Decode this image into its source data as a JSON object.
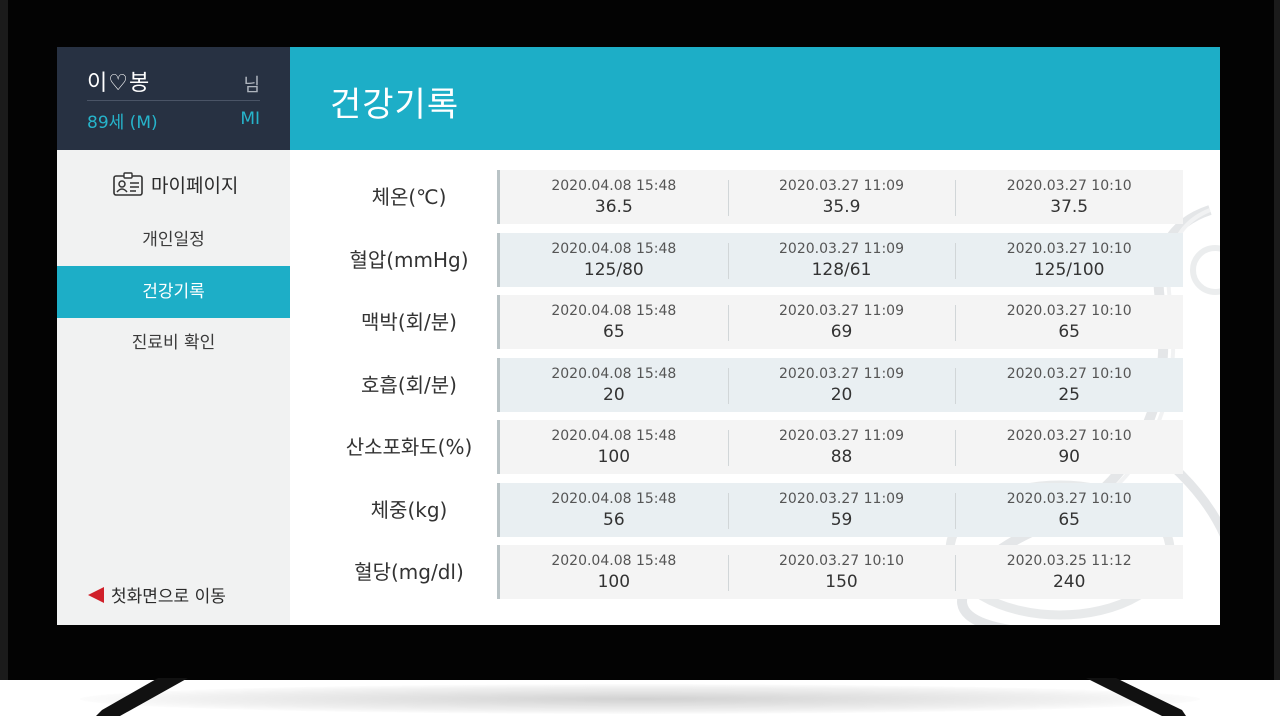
{
  "profile": {
    "name": "이♡봉",
    "honorific": "님",
    "age_num": "89",
    "age_suffix": "세 (M)",
    "grade": "MI"
  },
  "sidebar": {
    "mypage_label": "마이페이지",
    "items": [
      {
        "label": "개인일정",
        "active": false
      },
      {
        "label": "건강기록",
        "active": true
      },
      {
        "label": "진료비 확인",
        "active": false
      }
    ],
    "home_label": "첫화면으로 이동"
  },
  "header": {
    "title": "건강기록"
  },
  "records": [
    {
      "label": "체온(℃)",
      "entries": [
        {
          "date": "2020.04.08 15:48",
          "value": "36.5"
        },
        {
          "date": "2020.03.27 11:09",
          "value": "35.9"
        },
        {
          "date": "2020.03.27 10:10",
          "value": "37.5"
        }
      ]
    },
    {
      "label": "혈압(mmHg)",
      "entries": [
        {
          "date": "2020.04.08 15:48",
          "value": "125/80"
        },
        {
          "date": "2020.03.27 11:09",
          "value": "128/61"
        },
        {
          "date": "2020.03.27 10:10",
          "value": "125/100"
        }
      ]
    },
    {
      "label": "맥박(회/분)",
      "entries": [
        {
          "date": "2020.04.08 15:48",
          "value": "65"
        },
        {
          "date": "2020.03.27 11:09",
          "value": "69"
        },
        {
          "date": "2020.03.27 10:10",
          "value": "65"
        }
      ]
    },
    {
      "label": "호흡(회/분)",
      "entries": [
        {
          "date": "2020.04.08 15:48",
          "value": "20"
        },
        {
          "date": "2020.03.27 11:09",
          "value": "20"
        },
        {
          "date": "2020.03.27 10:10",
          "value": "25"
        }
      ]
    },
    {
      "label": "산소포화도(%)",
      "entries": [
        {
          "date": "2020.04.08 15:48",
          "value": "100"
        },
        {
          "date": "2020.03.27 11:09",
          "value": "88"
        },
        {
          "date": "2020.03.27 10:10",
          "value": "90"
        }
      ]
    },
    {
      "label": "체중(kg)",
      "entries": [
        {
          "date": "2020.04.08 15:48",
          "value": "56"
        },
        {
          "date": "2020.03.27 11:09",
          "value": "59"
        },
        {
          "date": "2020.03.27 10:10",
          "value": "65"
        }
      ]
    },
    {
      "label": "혈당(mg/dl)",
      "entries": [
        {
          "date": "2020.04.08 15:48",
          "value": "100"
        },
        {
          "date": "2020.03.27 10:10",
          "value": "150"
        },
        {
          "date": "2020.03.25 11:12",
          "value": "240"
        }
      ]
    }
  ],
  "colors": {
    "accent": "#1daec7",
    "profile_bg": "#273142",
    "sidebar_bg": "#f1f2f2",
    "row_light": "#f4f4f4",
    "row_blue": "#e9eff2",
    "home_arrow": "#d0202a"
  },
  "icons": {
    "mypage": "id-card-icon",
    "home": "red-arrow-left-icon"
  }
}
